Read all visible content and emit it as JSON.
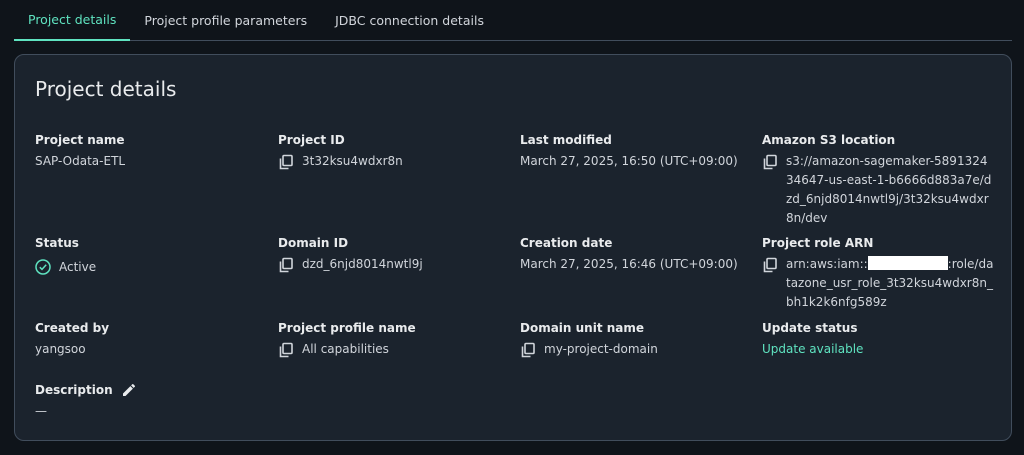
{
  "tabs": [
    {
      "label": "Project details",
      "active": true
    },
    {
      "label": "Project profile parameters",
      "active": false
    },
    {
      "label": "JDBC connection details",
      "active": false
    }
  ],
  "panel": {
    "title": "Project details",
    "project_name": {
      "label": "Project name",
      "value": "SAP-Odata-ETL"
    },
    "project_id": {
      "label": "Project ID",
      "value": "3t32ksu4wdxr8n"
    },
    "last_modified": {
      "label": "Last modified",
      "value": "March 27, 2025, 16:50 (UTC+09:00)"
    },
    "s3_location": {
      "label": "Amazon S3 location",
      "value": "s3://amazon-sagemaker-589132434647-us-east-1-b6666d883a7e/dzd_6njd8014nwtl9j/3t32ksu4wdxr8n/dev"
    },
    "status": {
      "label": "Status",
      "value": "Active"
    },
    "domain_id": {
      "label": "Domain ID",
      "value": "dzd_6njd8014nwtl9j"
    },
    "creation_date": {
      "label": "Creation date",
      "value": "March 27, 2025, 16:46 (UTC+09:00)"
    },
    "role_arn": {
      "label": "Project role ARN",
      "prefix": "arn:aws:iam::",
      "suffix": ":role/datazone_usr_role_3t32ksu4wdxr8n_bh1k2k6nfg589z"
    },
    "created_by": {
      "label": "Created by",
      "value": "yangsoo"
    },
    "profile_name": {
      "label": "Project profile name",
      "value": "All capabilities"
    },
    "domain_unit": {
      "label": "Domain unit name",
      "value": "my-project-domain"
    },
    "update_status": {
      "label": "Update status",
      "value": "Update available"
    },
    "description": {
      "label": "Description",
      "value": "—"
    }
  },
  "colors": {
    "accent": "#5fe3c0",
    "panel_bg": "#1b232d",
    "page_bg": "#0f141a"
  }
}
